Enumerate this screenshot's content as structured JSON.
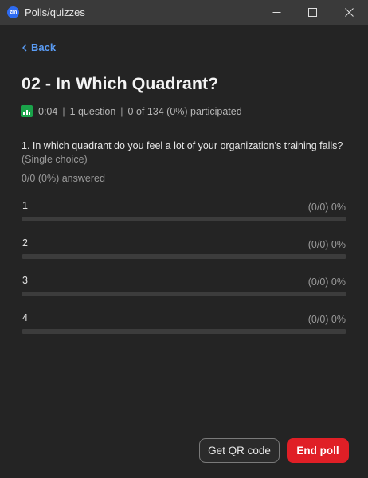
{
  "window": {
    "logo_text": "zm",
    "title": "Polls/quizzes",
    "colors": {
      "titlebar": "#3a3a3a",
      "background": "#242424",
      "accent": "#5a9cf5"
    }
  },
  "nav": {
    "back_label": "Back"
  },
  "poll": {
    "title": "02 - In Which Quadrant?",
    "duration": "0:04",
    "separator": "|",
    "question_count": "1 question",
    "participation": "0 of 134 (0%) participated",
    "status_icon": "bar-chart-icon",
    "status_color": "#1aa34a"
  },
  "question": {
    "text": "1. In which quadrant do you feel a lot of your organization's training falls?",
    "type": "(Single choice)",
    "answered": "0/0 (0%) answered"
  },
  "options": [
    {
      "label": "1",
      "stat": "(0/0) 0%",
      "fraction": 0
    },
    {
      "label": "2",
      "stat": "(0/0) 0%",
      "fraction": 0
    },
    {
      "label": "3",
      "stat": "(0/0) 0%",
      "fraction": 0
    },
    {
      "label": "4",
      "stat": "(0/0) 0%",
      "fraction": 0
    }
  ],
  "actions": {
    "qr_label": "Get QR code",
    "end_label": "End poll",
    "end_color": "#e01f26"
  }
}
